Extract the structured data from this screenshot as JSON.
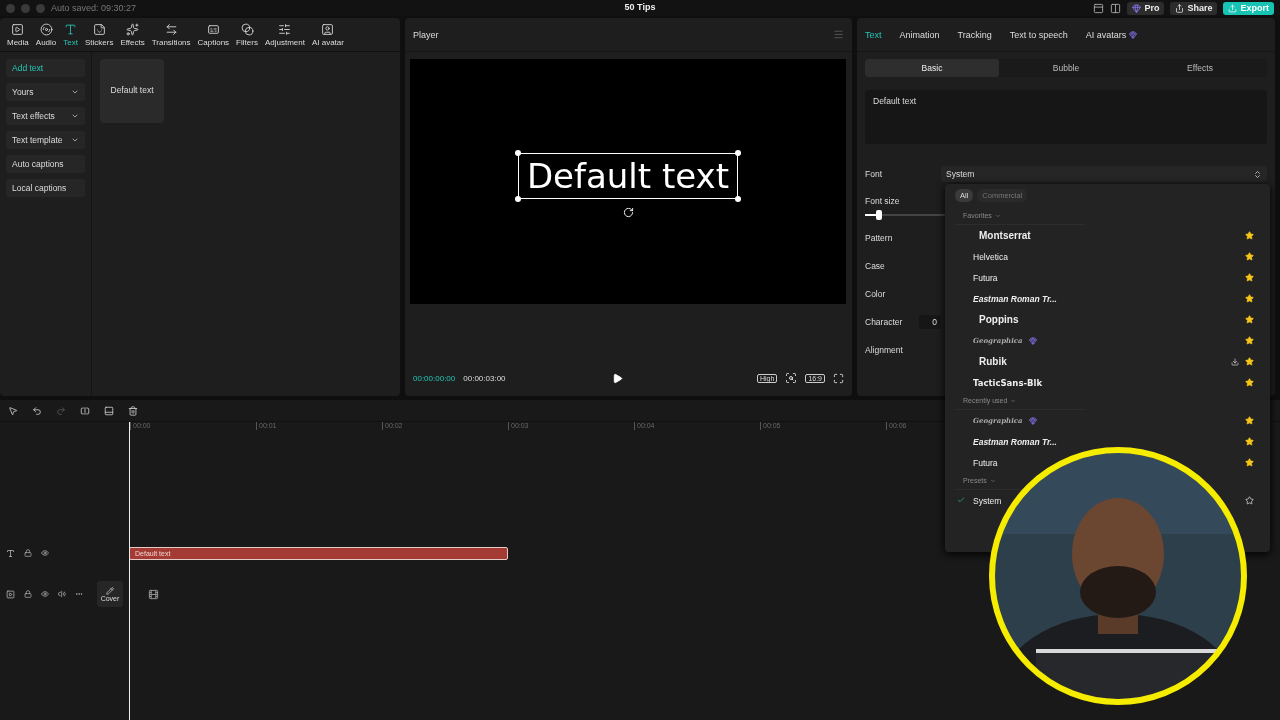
{
  "top_bar": {
    "autosave": "Auto saved: 09:30:27",
    "title": "50 Tips",
    "buttons": [
      {
        "label": "Pro",
        "kind": "pro"
      },
      {
        "label": "Share",
        "kind": "share"
      },
      {
        "label": "Export",
        "kind": "export"
      }
    ]
  },
  "media_tabs": [
    {
      "label": "Media",
      "selected": false
    },
    {
      "label": "Audio",
      "selected": false
    },
    {
      "label": "Text",
      "selected": true
    },
    {
      "label": "Stickers",
      "selected": false
    },
    {
      "label": "Effects",
      "selected": false
    },
    {
      "label": "Transitions",
      "selected": false
    },
    {
      "label": "Captions",
      "selected": false
    },
    {
      "label": "Filters",
      "selected": false
    },
    {
      "label": "Adjustment",
      "selected": false
    },
    {
      "label": "AI avatar",
      "selected": false
    }
  ],
  "side_menu": [
    {
      "label": "Add text",
      "selected": true,
      "expandable": false
    },
    {
      "label": "Yours",
      "selected": false,
      "expandable": true
    },
    {
      "label": "Text effects",
      "selected": false,
      "expandable": true
    },
    {
      "label": "Text template",
      "selected": false,
      "expandable": true
    },
    {
      "label": "Auto captions",
      "selected": false,
      "expandable": false
    },
    {
      "label": "Local captions",
      "selected": false,
      "expandable": false
    }
  ],
  "presets": [
    {
      "label": "Default text"
    }
  ],
  "player": {
    "title": "Player",
    "overlay_text": "Default text",
    "current_time": "00:00:00:00",
    "duration": "00:00:03:00",
    "quality": "High",
    "ratio": "16:9"
  },
  "inspector": {
    "tabs": [
      {
        "label": "Text",
        "selected": true,
        "premium": false
      },
      {
        "label": "Animation",
        "selected": false,
        "premium": false
      },
      {
        "label": "Tracking",
        "selected": false,
        "premium": false
      },
      {
        "label": "Text to speech",
        "selected": false,
        "premium": false
      },
      {
        "label": "AI avatars",
        "selected": false,
        "premium": true
      }
    ],
    "subtabs": [
      {
        "label": "Basic",
        "selected": true
      },
      {
        "label": "Bubble",
        "selected": false
      },
      {
        "label": "Effects",
        "selected": false
      }
    ],
    "text_value": "Default text",
    "font_label": "Font",
    "font_value": "System",
    "font_size_label": "Font size",
    "font_size": {
      "level": 0.18
    },
    "rows": [
      {
        "label": "Pattern"
      },
      {
        "label": "Case"
      },
      {
        "label": "Color"
      },
      {
        "label": "Character",
        "value": "0"
      },
      {
        "label": "Alignment"
      }
    ]
  },
  "font_menu": {
    "filters": [
      {
        "label": "All",
        "selected": true
      },
      {
        "label": "Commercial",
        "selected": false
      }
    ],
    "sections": [
      {
        "title": "Favorites",
        "fonts": [
          {
            "name": "Montserrat",
            "kind": "heavy",
            "starred": true,
            "premium": false,
            "download": false,
            "selected": false
          },
          {
            "name": "Helvetica",
            "kind": "regular",
            "starred": true,
            "premium": false,
            "download": false,
            "selected": false
          },
          {
            "name": "Futura",
            "kind": "regular",
            "starred": true,
            "premium": false,
            "download": false,
            "selected": false
          },
          {
            "name": "Eastman Roman Tr...",
            "kind": "italic",
            "starred": true,
            "premium": false,
            "download": false,
            "selected": false
          },
          {
            "name": "Poppins",
            "kind": "heavy",
            "starred": true,
            "premium": false,
            "download": false,
            "selected": false
          },
          {
            "name": "Geographica",
            "kind": "script",
            "starred": true,
            "premium": true,
            "download": false,
            "selected": false
          },
          {
            "name": "Rubik",
            "kind": "heavy",
            "starred": true,
            "premium": false,
            "download": true,
            "selected": false
          },
          {
            "name": "TacticSans-Blk",
            "kind": "black",
            "starred": true,
            "premium": false,
            "download": false,
            "selected": false
          }
        ]
      },
      {
        "title": "Recently used",
        "fonts": [
          {
            "name": "Geographica",
            "kind": "script",
            "starred": true,
            "premium": true,
            "download": false,
            "selected": false
          },
          {
            "name": "Eastman Roman Tr...",
            "kind": "italic",
            "starred": true,
            "premium": false,
            "download": false,
            "selected": false
          },
          {
            "name": "Futura",
            "kind": "regular",
            "starred": true,
            "premium": false,
            "download": false,
            "selected": false
          }
        ]
      },
      {
        "title": "Presets",
        "fonts": [
          {
            "name": "System",
            "kind": "regular",
            "starred": false,
            "premium": false,
            "download": false,
            "selected": true
          }
        ]
      }
    ]
  },
  "timeline": {
    "ruler": [
      "00:00",
      "00:01",
      "00:02",
      "00:03",
      "00:04",
      "00:05",
      "00:06"
    ],
    "tracks": [
      {
        "kind": "text",
        "clip": "Default text"
      },
      {
        "kind": "video",
        "cover": "Cover"
      }
    ]
  }
}
